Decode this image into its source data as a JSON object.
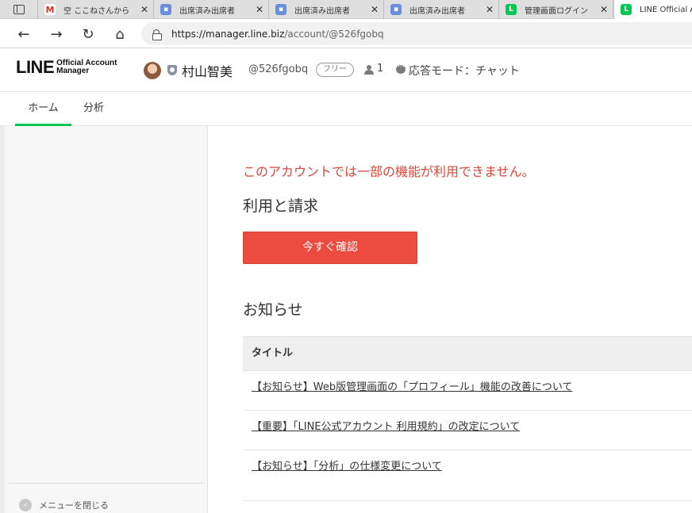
{
  "browser": {
    "tabs": [
      {
        "title": "空 ここねさんから",
        "favicon": "gmail-icon"
      },
      {
        "title": "出席済み出席者",
        "favicon": "zoom-icon"
      },
      {
        "title": "出席済み出席者",
        "favicon": "zoom-icon"
      },
      {
        "title": "出席済み出席者",
        "favicon": "zoom-icon"
      },
      {
        "title": "管理画面ログイン",
        "favicon": "line-icon"
      },
      {
        "title": "LINE Official A",
        "favicon": "line-icon"
      }
    ],
    "url_host": "https://manager.line.biz",
    "url_path": "/account/@526fgobq"
  },
  "header": {
    "logo_big": "LINE",
    "logo_line1": "Official Account",
    "logo_line2": "Manager",
    "account_name": "村山智美",
    "account_id": "@526fgobq",
    "plan": "フリー",
    "friends_count": "1",
    "mode": "応答モード：チャット"
  },
  "nav": {
    "tabs": [
      "ホーム",
      "分析"
    ],
    "active": "ホーム"
  },
  "sidebar": {
    "collapse_label": "メニューを閉じる"
  },
  "main": {
    "warning": "このアカウントでは一部の機能が利用できません。",
    "billing_heading": "利用と請求",
    "cta_label": "今すぐ確認",
    "news_heading": "お知らせ",
    "table_header": "タイトル",
    "news_items": [
      "【お知らせ】Web版管理画面の「プロフィール」機能の改善について",
      "【重要】「LINE公式アカウント 利用規約」の改定について",
      "【お知らせ】「分析」の仕様変更について"
    ]
  },
  "colors": {
    "accent_green": "#06c755",
    "warning_red": "#d9483b",
    "cta_red": "#eb4c3f"
  }
}
